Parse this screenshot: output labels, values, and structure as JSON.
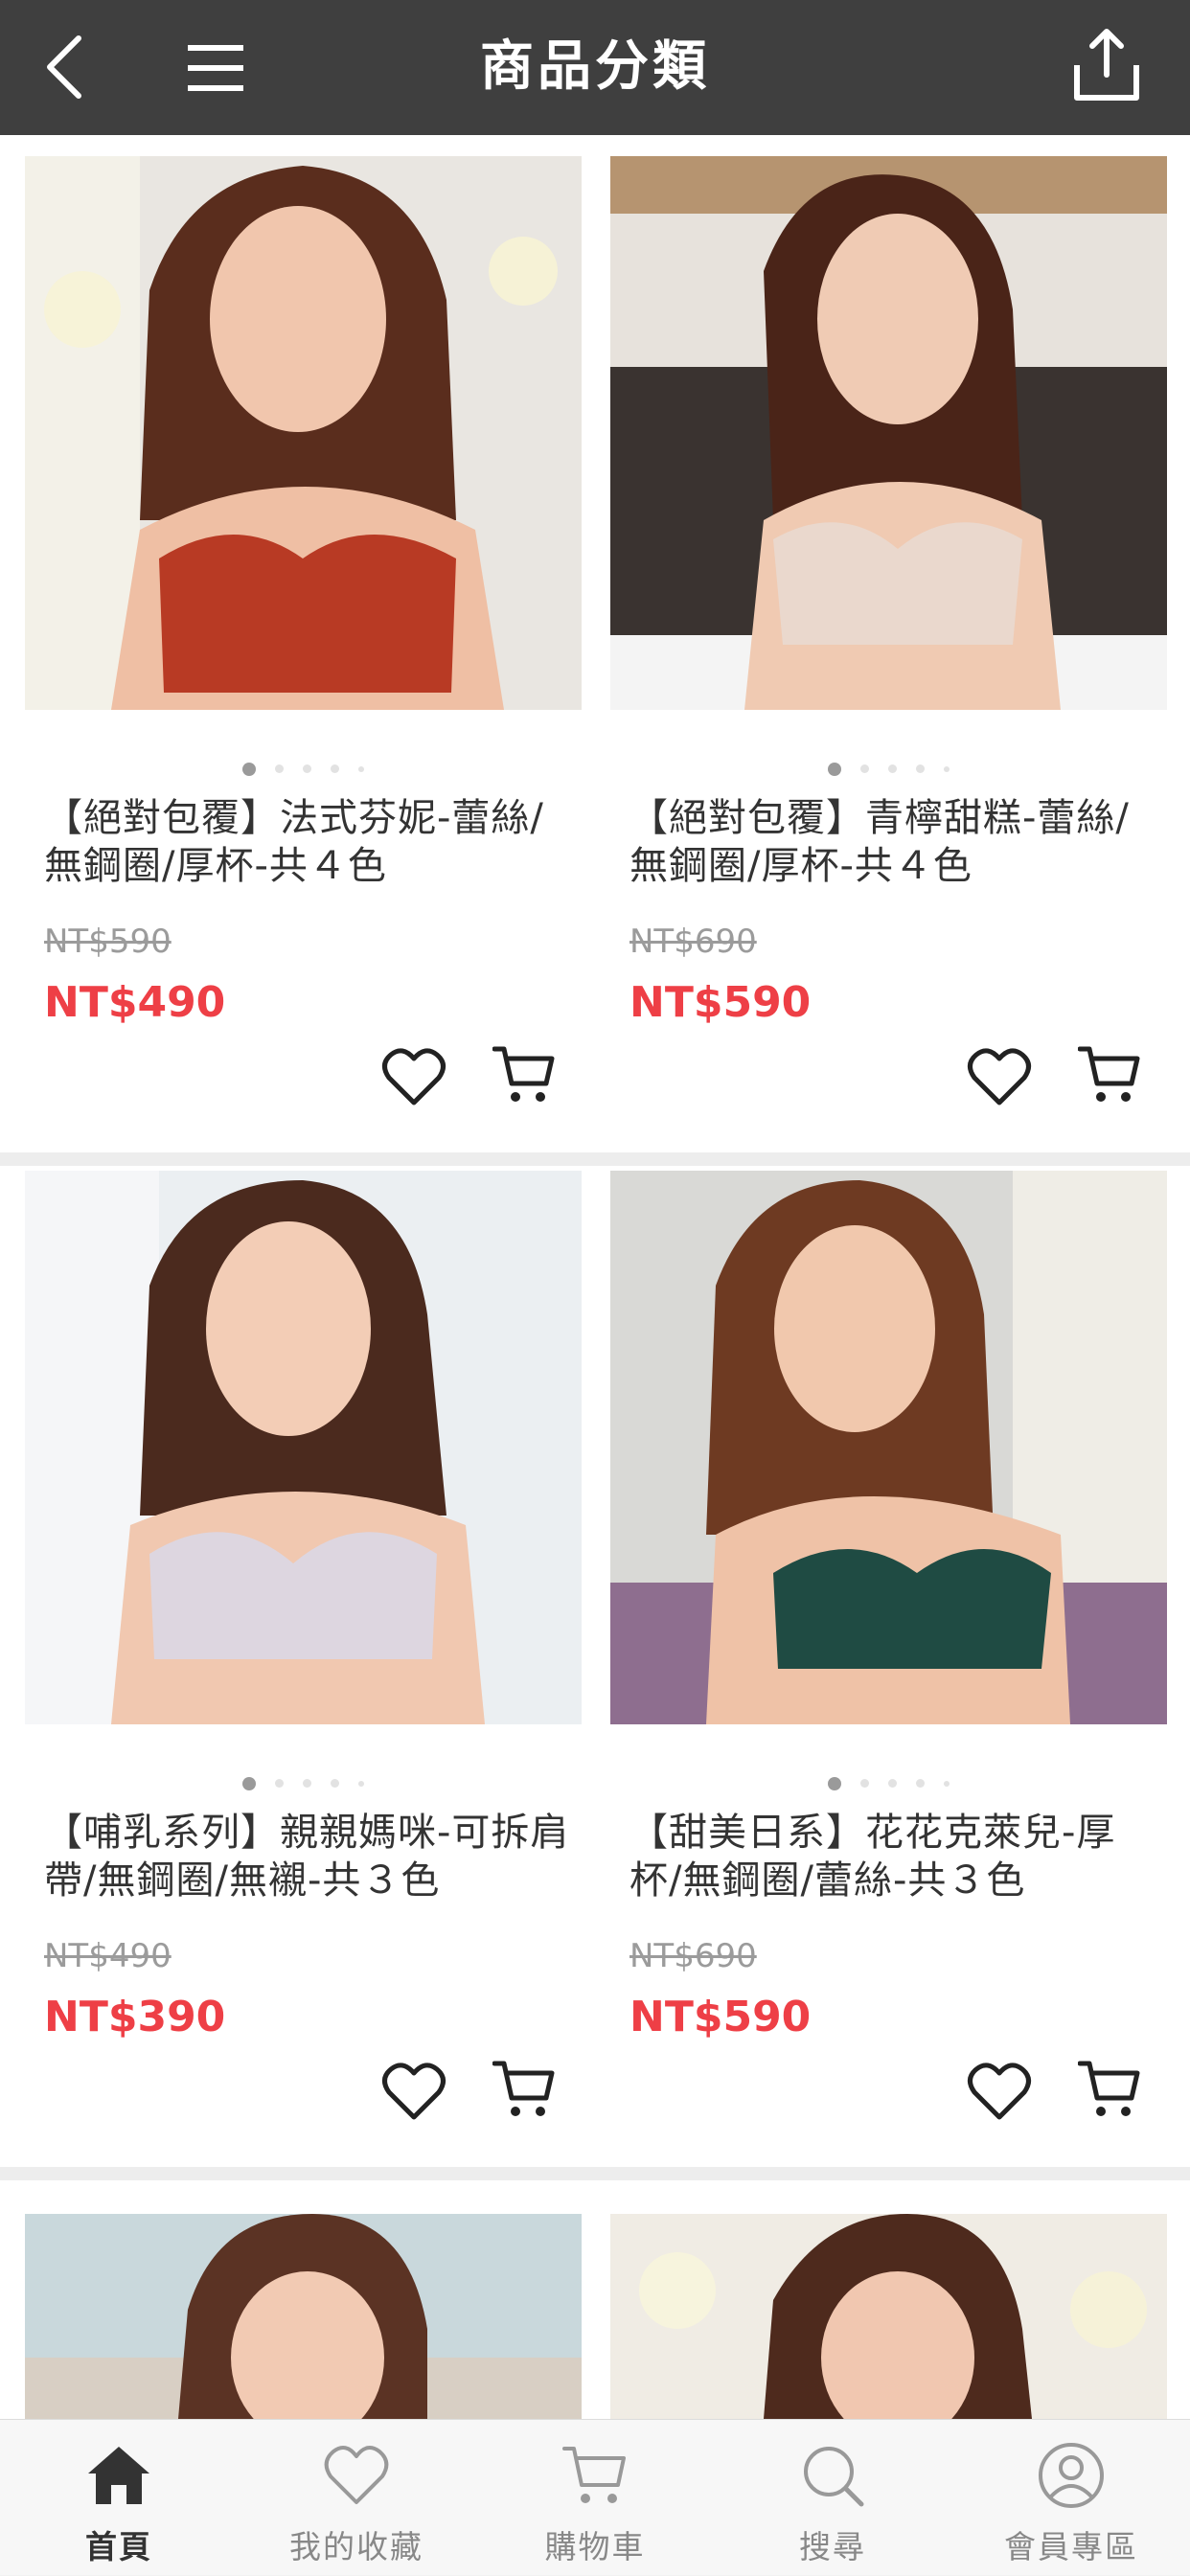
{
  "header": {
    "title": "商品分類",
    "back_icon": "chevron-left-icon",
    "menu_icon": "hamburger-menu-icon",
    "share_icon": "share-upload-icon"
  },
  "products": [
    {
      "name": "【絕對包覆】法式芬妮-蕾絲/無鋼圈/厚杯-共４色",
      "original_price": "NT$590",
      "price": "NT$490",
      "image": "model-red-lace-bra",
      "image_color": "#b83a24"
    },
    {
      "name": "【絕對包覆】青檸甜糕-蕾絲/無鋼圈/厚杯-共４色",
      "original_price": "NT$690",
      "price": "NT$590",
      "image": "model-beige-bra",
      "image_color": "#ead8cd"
    },
    {
      "name": "【哺乳系列】親親媽咪-可拆肩帶/無鋼圈/無襯-共３色",
      "original_price": "NT$490",
      "price": "NT$390",
      "image": "model-lilac-nursing-bra",
      "image_color": "#ddd6e0"
    },
    {
      "name": "【甜美日系】花花克萊兒-厚杯/無鋼圈/蕾絲-共３色",
      "original_price": "NT$690",
      "price": "NT$590",
      "image": "model-green-lace-bra",
      "image_color": "#1f4b43"
    },
    {
      "image": "model-partial-5",
      "image_color": "#c9d8dc"
    },
    {
      "image": "model-partial-6",
      "image_color": "#f0ece4"
    }
  ],
  "tabs": [
    {
      "label": "首頁",
      "icon": "home-icon",
      "active": true
    },
    {
      "label": "我的收藏",
      "icon": "heart-icon",
      "active": false
    },
    {
      "label": "購物車",
      "icon": "cart-icon",
      "active": false
    },
    {
      "label": "搜尋",
      "icon": "search-icon",
      "active": false
    },
    {
      "label": "會員專區",
      "icon": "account-icon",
      "active": false
    }
  ],
  "colors": {
    "header_bg": "#3f3f3f",
    "price_red": "#ee3f46",
    "strike_gray": "#9b9b9b"
  }
}
